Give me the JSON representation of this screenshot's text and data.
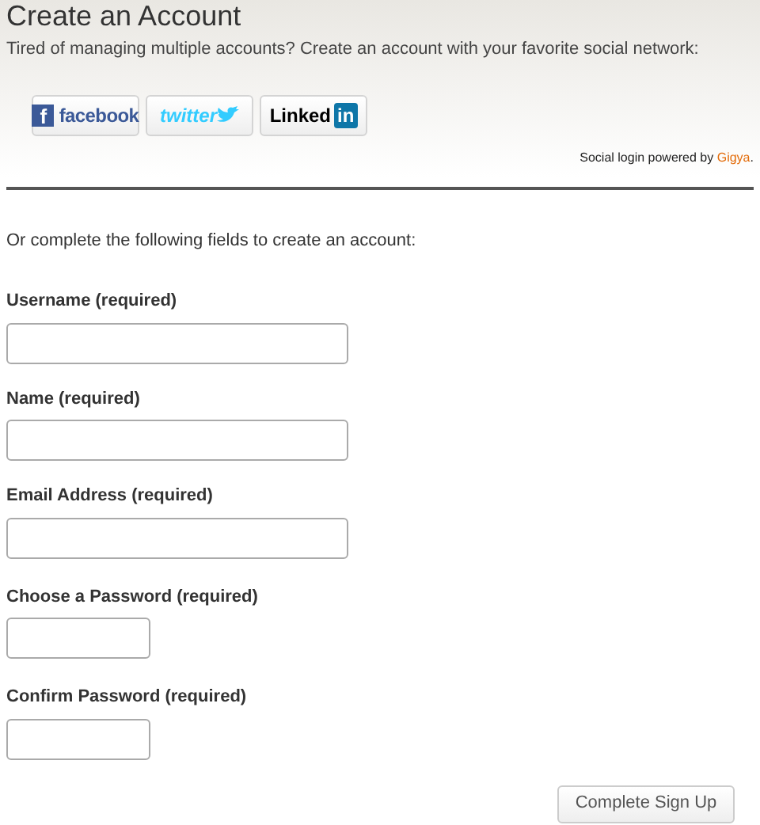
{
  "header": {
    "title": "Create an Account",
    "subtitle": "Tired of managing multiple accounts? Create an account with your favorite social network:"
  },
  "social_buttons": [
    {
      "kind": "facebook",
      "label": "facebook",
      "mark": "f"
    },
    {
      "kind": "twitter",
      "label": "twitter"
    },
    {
      "kind": "linkedin",
      "label": "Linked",
      "mark": "in"
    }
  ],
  "powered_by": {
    "text": "Social login powered by",
    "link": "Gigya",
    "suffix": "."
  },
  "intro": "Or complete the following fields to create an account:",
  "fields": [
    {
      "label": "Username (required)",
      "kind": "wide"
    },
    {
      "label": "Name (required)",
      "kind": "wide"
    },
    {
      "label": "Email Address (required)",
      "kind": "wide"
    },
    {
      "label": "Choose a Password (required)",
      "kind": "short"
    },
    {
      "label": "Confirm Password (required)",
      "kind": "short"
    }
  ],
  "submit": "Complete Sign Up"
}
